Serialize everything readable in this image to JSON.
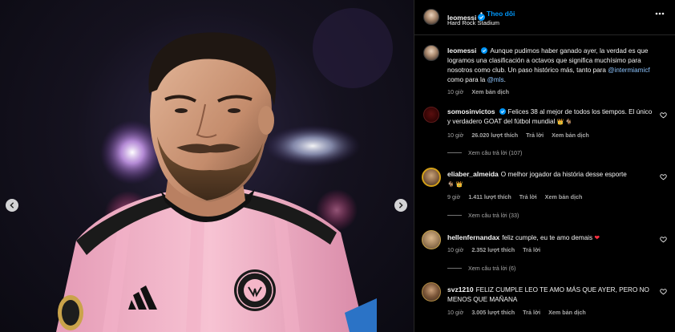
{
  "post": {
    "username": "leomessi",
    "follow_label": "Theo dõi",
    "location": "Hard Rock Stadium",
    "caption_text": "Aunque pudimos haber ganado ayer, la verdad es que logramos una clasificación a octavos que significa muchísimo para nosotros como club. Un paso histórico más, tanto para ",
    "caption_mention_1": "@intermiamicf",
    "caption_mid": " como para la ",
    "caption_mention_2": "@mls",
    "caption_end": ".",
    "caption_time": "10 giờ",
    "caption_translate": "Xem bản dịch"
  },
  "comments": [
    {
      "username": "somosinvictos",
      "text": "Felices 38 al mejor de todos los tiempos. El único y verdadero GOAT del fútbol mundial",
      "emoji": "👑 🐐",
      "time": "10 giờ",
      "likes": "26.020 lượt thích",
      "reply": "Trả lời",
      "translate": "Xem bản dịch",
      "view_replies": "Xem câu trả lời (107)"
    },
    {
      "username": "eliaber_almeida",
      "text": "O melhor jogador da história desse esporte",
      "emoji": "🐐 👑",
      "time": "9 giờ",
      "likes": "1.411 lượt thích",
      "reply": "Trả lời",
      "translate": "Xem bản dịch",
      "view_replies": "Xem câu trả lời (33)"
    },
    {
      "username": "hellenfernandax",
      "text": "feliz cumple, eu te amo demais",
      "emoji": "❤",
      "time": "10 giờ",
      "likes": "2.352 lượt thích",
      "reply": "Trả lời",
      "view_replies": "Xem câu trả lời (6)"
    },
    {
      "username": "svz1210",
      "text": "FELIZ CUMPLE LEO TE AMO MÁS QUE AYER, PERO NO MENOS QUE MAÑANA",
      "time": "10 giờ",
      "likes": "3.005 lượt thích",
      "reply": "Trả lời",
      "translate": "Xem bản dịch"
    }
  ],
  "icons": {
    "more": "more-options-icon",
    "verified": "verified-badge-icon",
    "like": "heart-outline-icon",
    "prev": "chevron-left-icon",
    "next": "chevron-right-icon"
  },
  "colors": {
    "accent": "#0095f6",
    "jersey_pink": "#f4b6c8",
    "background": "#000000"
  }
}
